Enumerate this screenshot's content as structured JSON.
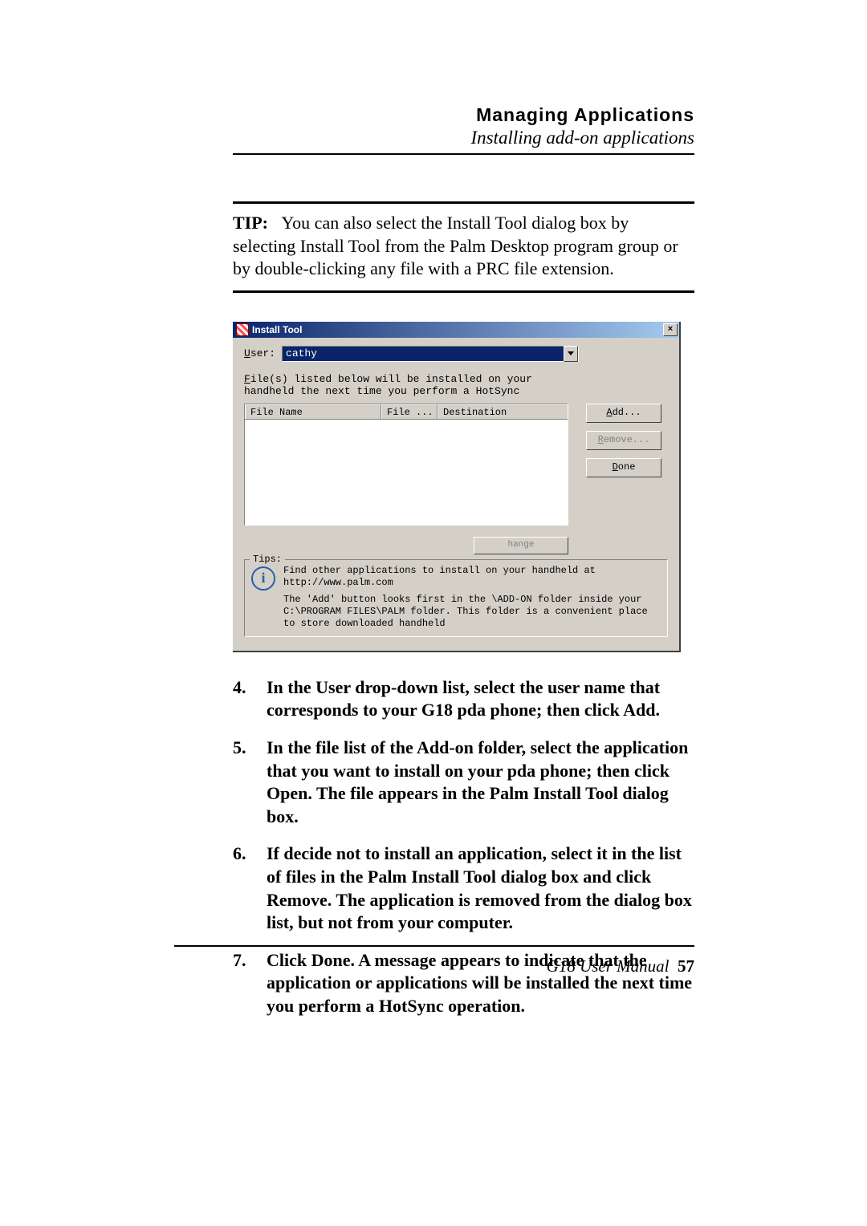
{
  "header": {
    "chapter": "Managing Applications",
    "section": "Installing add-on applications"
  },
  "tip": {
    "label": "TIP:",
    "text": "You can also select the Install Tool dialog box by selecting Install Tool from the Palm Desktop program group or by double-clicking any file with a PRC file extension."
  },
  "dialog": {
    "title": "Install Tool",
    "close_glyph": "×",
    "user_label_pre": "U",
    "user_label_rest": "ser:",
    "user_value": "cathy",
    "info_line_pre": "F",
    "info_line_rest": "ile(s) listed below will be installed on your",
    "info_line2": "handheld the next time you perform a HotSync",
    "columns": {
      "c1": "File Name",
      "c2": "File ...",
      "c3": "Destination"
    },
    "buttons": {
      "add_u": "A",
      "add_rest": "dd...",
      "remove_u": "R",
      "remove_rest": "emove...",
      "done_u": "D",
      "done_rest": "one"
    },
    "change_dest": "hange Destination..",
    "tips_legend": "Tips:",
    "tips_line1": "Find other applications to install on your handheld at http://www.palm.com",
    "tips_line2": "The 'Add' button looks first in the \\ADD-ON folder inside your C:\\PROGRAM FILES\\PALM folder. This folder is a convenient place to store downloaded handheld"
  },
  "steps": [
    {
      "no": "4.",
      "text": "In the User drop-down list, select the user name that corresponds to your G18 pda phone; then click Add."
    },
    {
      "no": "5.",
      "text": "In the file list of the Add-on folder, select the application that you want to install on your pda phone; then click Open. The file appears in the Palm Install Tool dialog box."
    },
    {
      "no": "6.",
      "text": "If decide not to install an application, select it in the list of files in the Palm Install Tool dialog box and click Remove. The application is removed from the dialog box list, but not from your computer."
    },
    {
      "no": "7.",
      "text": "Click Done. A message appears to indicate that the application or applications will be installed the next time you perform a HotSync operation."
    }
  ],
  "footer": {
    "manual": "G18 User Manual",
    "page": "57"
  }
}
